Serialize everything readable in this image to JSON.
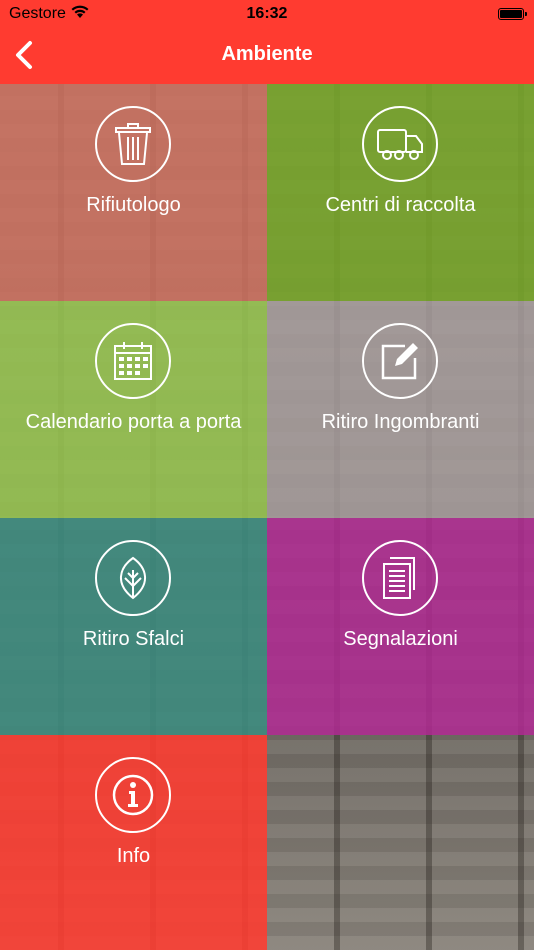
{
  "status_bar": {
    "carrier": "Gestore",
    "time": "16:32"
  },
  "nav": {
    "title": "Ambiente"
  },
  "tiles": [
    {
      "label": "Rifiutologo",
      "color": "rgba(206,112,94,0.85)",
      "icon": "trash-icon"
    },
    {
      "label": "Centri di raccolta",
      "color": "rgba(118,165,40,0.88)",
      "icon": "truck-icon"
    },
    {
      "label": "Calendario porta a porta",
      "color": "rgba(150,196,80,0.88)",
      "icon": "calendar-icon"
    },
    {
      "label": "Ritiro Ingombranti",
      "color": "rgba(170,160,160,0.82)",
      "icon": "edit-icon"
    },
    {
      "label": "Ritiro Sfalci",
      "color": "rgba(60,140,128,0.88)",
      "icon": "leaf-icon"
    },
    {
      "label": "Segnalazioni",
      "color": "rgba(180,40,150,0.82)",
      "icon": "documents-icon"
    },
    {
      "label": "Info",
      "color": "rgba(255,59,48,0.88)",
      "icon": "info-icon"
    }
  ]
}
